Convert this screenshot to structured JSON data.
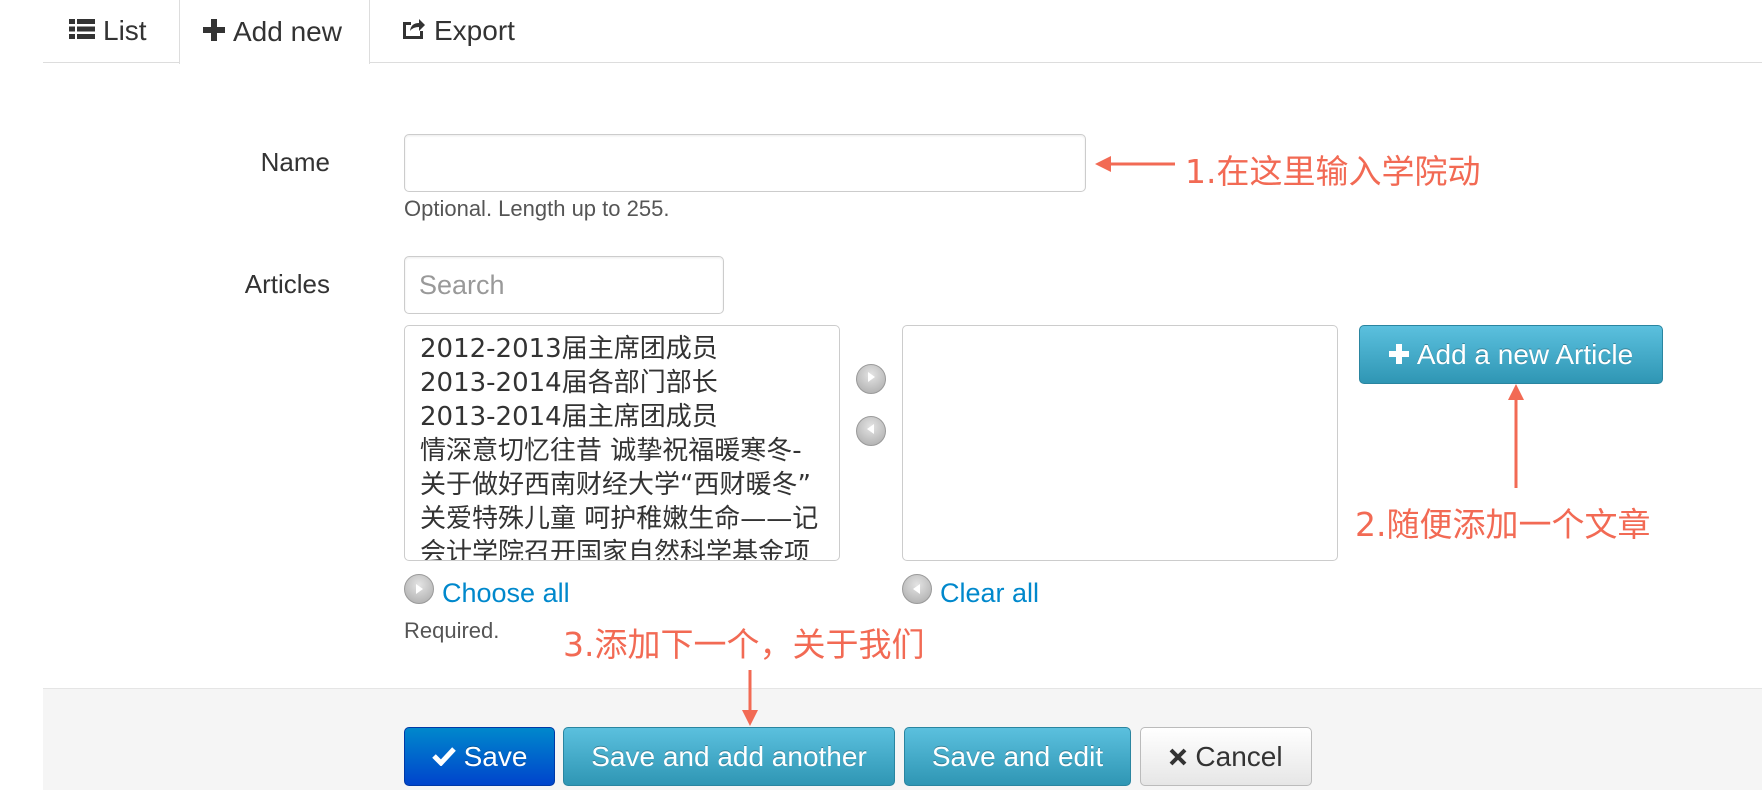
{
  "tabs": [
    {
      "label": "List",
      "icon": "list-icon"
    },
    {
      "label": "Add new",
      "icon": "plus-icon"
    },
    {
      "label": "Export",
      "icon": "export-icon"
    }
  ],
  "form": {
    "name_label": "Name",
    "name_value": "",
    "name_help": "Optional. Length up to 255.",
    "articles_label": "Articles",
    "search_placeholder": "Search",
    "available_articles": [
      "2012-2013届主席团成员",
      "2013-2014届各部门部长",
      "2013-2014届主席团成员",
      "情深意切忆往昔 诚挚祝福暖寒冬-",
      "关于做好西南财经大学“西财暖冬”",
      "关爱特殊儿童 呵护稚嫩生命——记",
      "会计学院召开国家自然科学基金项"
    ],
    "selected_articles": [],
    "choose_all": "Choose all",
    "clear_all": "Clear all",
    "articles_help": "Required.",
    "add_article_button": "Add a new Article"
  },
  "actions": {
    "save": "Save",
    "save_add_another": "Save and add another",
    "save_edit": "Save and edit",
    "cancel": "Cancel"
  },
  "annotations": {
    "a1": "1.在这里输入学院动",
    "a2": "2.随便添加一个文章",
    "a3": "3.添加下一个，关于我们"
  },
  "colors": {
    "annotation": "#f26a54",
    "link": "#0088cc",
    "primary": "#0044cc",
    "info": "#2f96b4"
  }
}
